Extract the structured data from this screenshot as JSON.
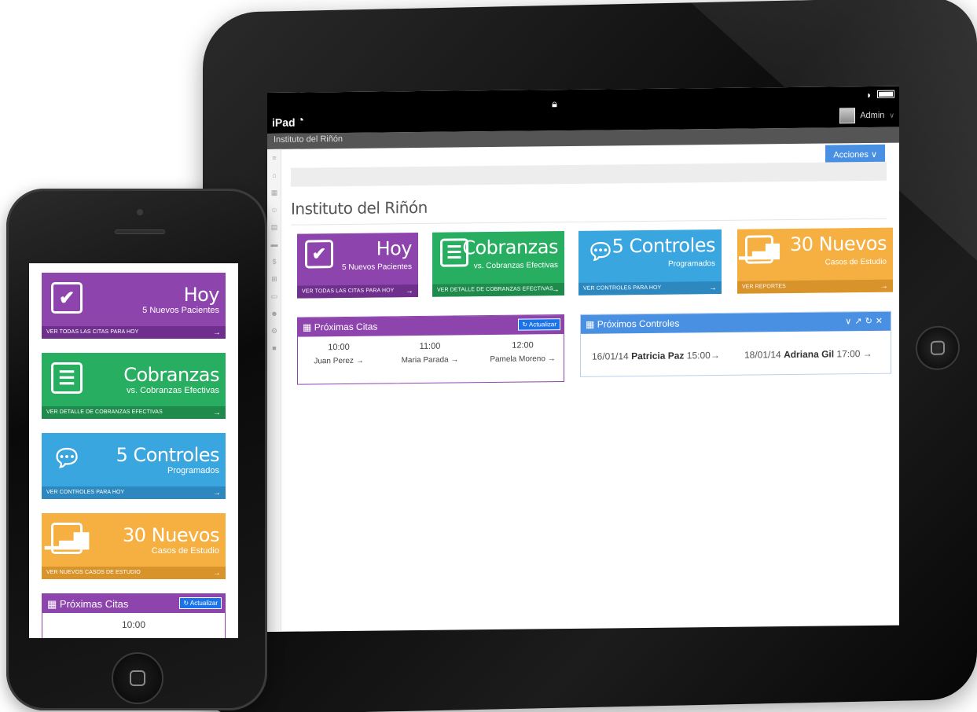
{
  "status": {
    "device": "iPad"
  },
  "header": {
    "user": "Admin",
    "app_name": "Instituto del Riñón",
    "actions_label": "Acciones"
  },
  "page": {
    "title": "Instituto del Riñón"
  },
  "tiles": [
    {
      "title": "Hoy",
      "subtitle": "5 Nuevos Pacientes",
      "footer": "VER TODAS LAS CITAS PARA HOY",
      "icon": "checkbox-icon",
      "color": "#8e44ad"
    },
    {
      "title": "Cobranzas",
      "subtitle": "vs. Cobranzas Efectivas",
      "footer": "VER DETALLE DE COBRANZAS EFECTIVAS",
      "icon": "document-icon",
      "color": "#27ae60"
    },
    {
      "title": "5 Controles",
      "subtitle": "Programados",
      "footer": "VER CONTROLES PARA HOY",
      "icon": "chat-icon",
      "color": "#3aa6e0"
    },
    {
      "title": "30 Nuevos",
      "subtitle": "Casos de Estudio",
      "footer": "VER REPORTES",
      "icon": "bar-chart-icon",
      "color": "#f5b041"
    }
  ],
  "phone_orange_footer": "VER NUEVOS CASOS DE ESTUDIO",
  "citas": {
    "title": "Próximas Citas",
    "refresh_label": "Actualizar",
    "items": [
      {
        "time": "10:00",
        "name": "Juan Perez"
      },
      {
        "time": "11:00",
        "name": "Maria Parada"
      },
      {
        "time": "12:00",
        "name": "Pamela Moreno"
      }
    ]
  },
  "controles": {
    "title": "Próximos Controles",
    "items": [
      {
        "date": "16/01/14",
        "name": "Patricia Paz",
        "time": "15:00"
      },
      {
        "date": "18/01/14",
        "name": "Adriana Gil",
        "time": "17:00"
      }
    ]
  }
}
